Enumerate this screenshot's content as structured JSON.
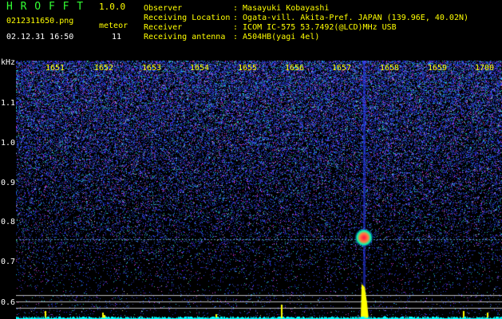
{
  "app": {
    "title": "H R O F F T",
    "version": "1.0.0",
    "filename": "0212311650.png",
    "datetime": "02.12.31 16:50",
    "meteor_label": "meteor",
    "meteor_count": "11"
  },
  "info": {
    "labels": [
      "Observer",
      "Receiving Location",
      "Receiver",
      "Receiving antenna"
    ],
    "values": [
      ": Masayuki Kobayashi",
      ": Ogata-vill. Akita-Pref. JAPAN (139.96E, 40.02N)",
      ": ICOM IC-575 53.7492(@LCD)MHz USB",
      ": A504HB(yagi 4el)"
    ]
  },
  "spectrogram": {
    "y_unit": "kHz",
    "y_labels": [
      "1.1",
      "1.0",
      "0.9",
      "0.8",
      "0.7",
      "0.6"
    ],
    "x_labels": [
      "1651",
      "1652",
      "1653",
      "1654",
      "1655",
      "1656",
      "1657",
      "1658",
      "1659",
      "1700"
    ],
    "meteor_time_label": "1657",
    "colors": {
      "background": "#000000",
      "noise": "#2a3aff",
      "echo_core": "#ff2040",
      "echo_edge": "#00ffaa",
      "signal_bars": "#ffff00",
      "baseline": "#00ffff"
    }
  }
}
